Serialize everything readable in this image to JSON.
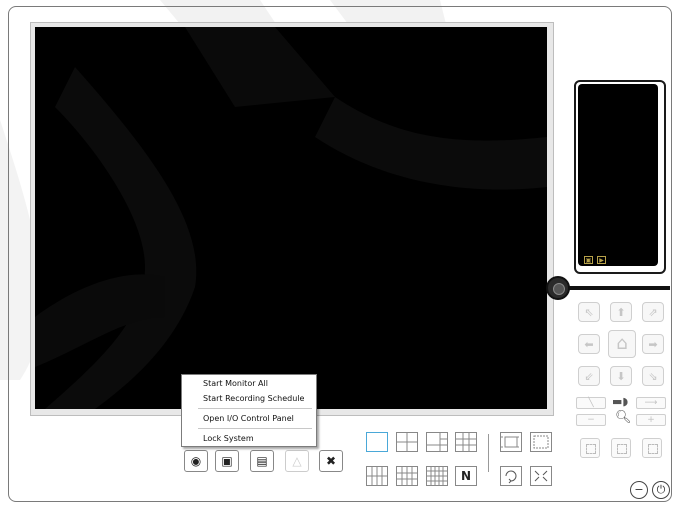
{
  "context_menu": {
    "items": [
      {
        "label": "Start Monitor All"
      },
      {
        "label": "Start Recording Schedule"
      },
      {
        "label": "Open I/O Control Panel"
      },
      {
        "label": "Lock System"
      }
    ]
  },
  "toolbar": {
    "buttons": [
      {
        "icon": "record-icon",
        "glyph": "◉"
      },
      {
        "icon": "tv-icon",
        "glyph": "▣"
      },
      {
        "icon": "keyboard-icon",
        "glyph": "▤"
      },
      {
        "icon": "alert-icon",
        "glyph": "△"
      },
      {
        "icon": "tools-icon",
        "glyph": "✖"
      }
    ],
    "layouts": [
      {
        "icon": "layout-1-icon"
      },
      {
        "icon": "layout-4-icon"
      },
      {
        "icon": "layout-6-icon"
      },
      {
        "icon": "layout-9-icon"
      },
      {
        "icon": "layout-13-icon"
      },
      {
        "icon": "layout-16-icon"
      },
      {
        "icon": "layout-16b-icon"
      },
      {
        "icon": "layout-25-icon"
      },
      {
        "icon": "layout-n-icon",
        "glyph": "N"
      },
      {
        "icon": "layout-custom-icon"
      },
      {
        "icon": "layout-sequence-icon"
      },
      {
        "icon": "fullscreen-icon"
      }
    ]
  },
  "ptz": {
    "arrows": [
      {
        "icon": "arrow-upleft-icon",
        "glyph": "⇖"
      },
      {
        "icon": "arrow-up-icon",
        "glyph": "⬆"
      },
      {
        "icon": "arrow-upright-icon",
        "glyph": "⇗"
      },
      {
        "icon": "arrow-left-icon",
        "glyph": "⬅"
      },
      {
        "icon": "home-icon",
        "glyph": "⌂"
      },
      {
        "icon": "arrow-right-icon",
        "glyph": "➡"
      },
      {
        "icon": "arrow-downleft-icon",
        "glyph": "⇙"
      },
      {
        "icon": "arrow-down-icon",
        "glyph": "⬇"
      },
      {
        "icon": "arrow-downright-icon",
        "glyph": "⇘"
      }
    ],
    "minus": "−",
    "plus": "+"
  },
  "window_buttons": {
    "minimize": "−",
    "power": "⏻"
  },
  "colors": {
    "video_bg": "#000000",
    "active_layout": "#4aa8d8",
    "preview_icon": "#b7a24a"
  }
}
